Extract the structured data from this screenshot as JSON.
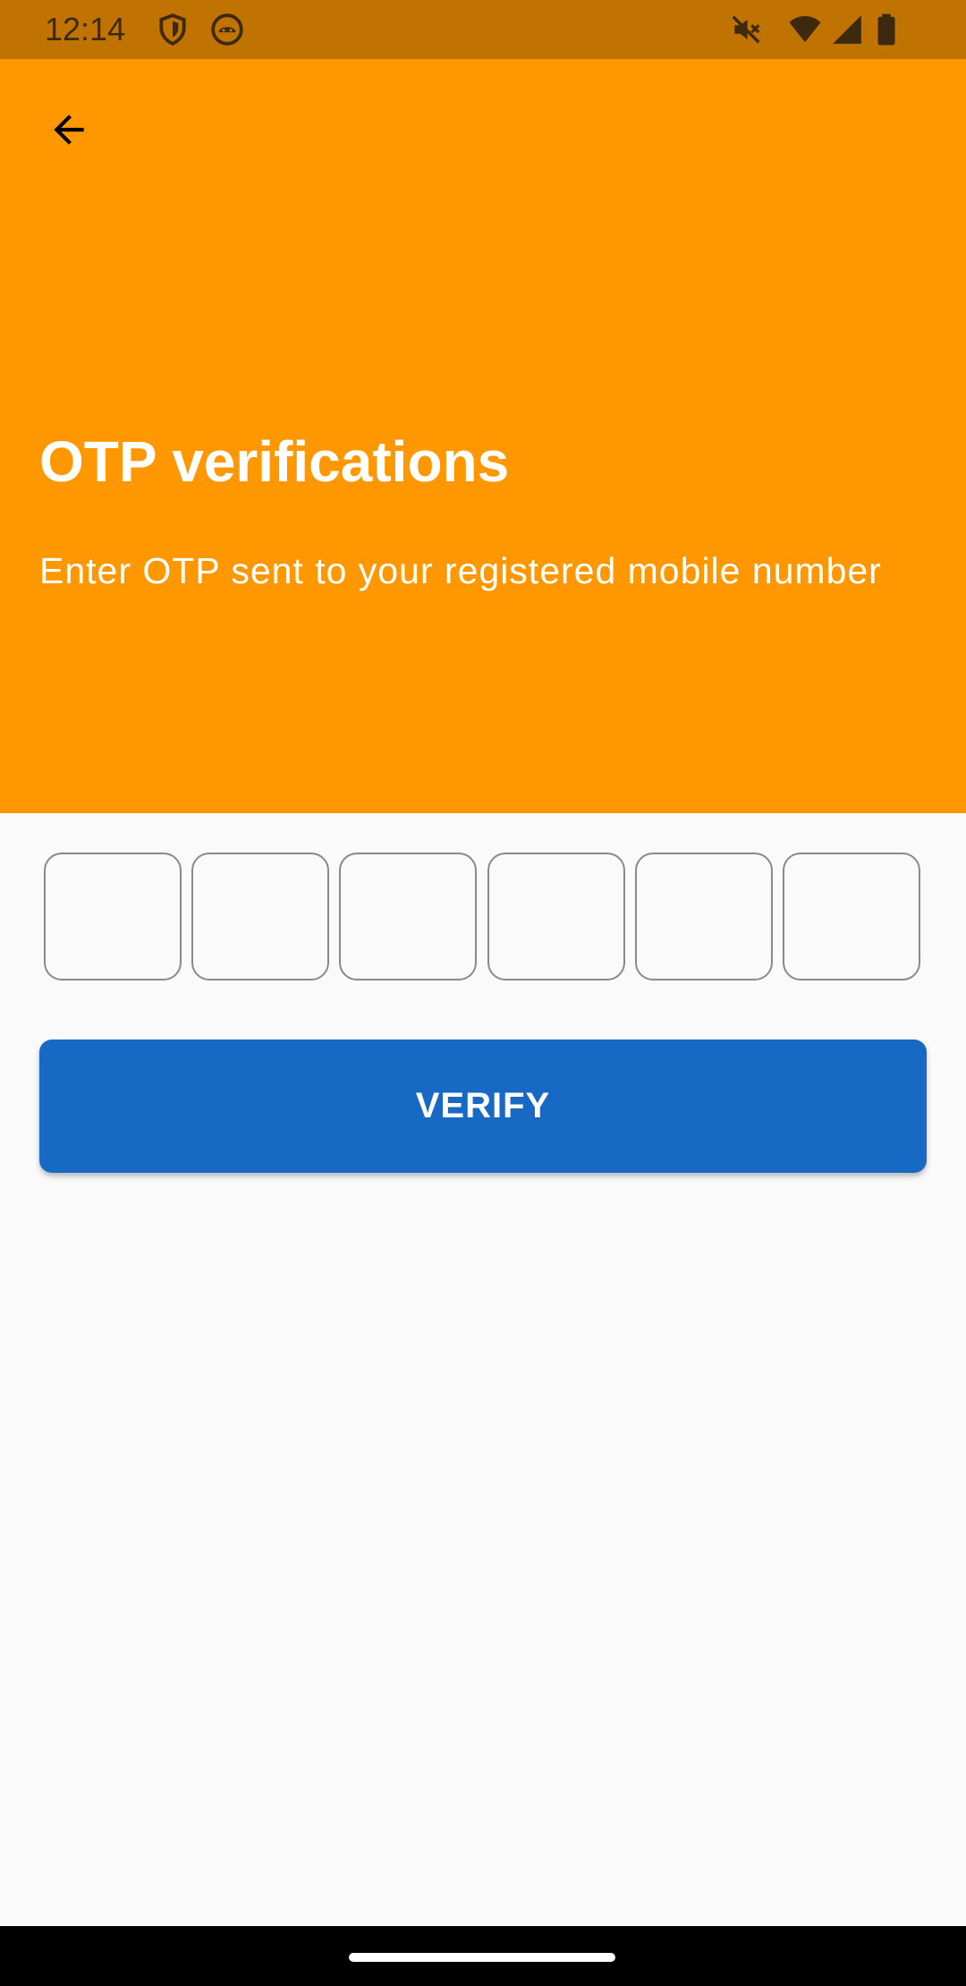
{
  "status_bar": {
    "time": "12:14",
    "icons": [
      "shield-icon",
      "android-face-icon",
      "mute-icon",
      "wifi-icon",
      "signal-icon",
      "battery-icon"
    ]
  },
  "header": {
    "back_icon": "arrow-back-icon",
    "title": "OTP verifications",
    "subtitle": "Enter OTP sent to your registered mobile number"
  },
  "otp": {
    "digits": [
      "",
      "",
      "",
      "",
      "",
      ""
    ]
  },
  "verify_button": {
    "label": "VERIFY"
  },
  "colors": {
    "status_bar": "#c07300",
    "header": "#ff9800",
    "button": "#1769c4",
    "background": "#fafafa"
  }
}
